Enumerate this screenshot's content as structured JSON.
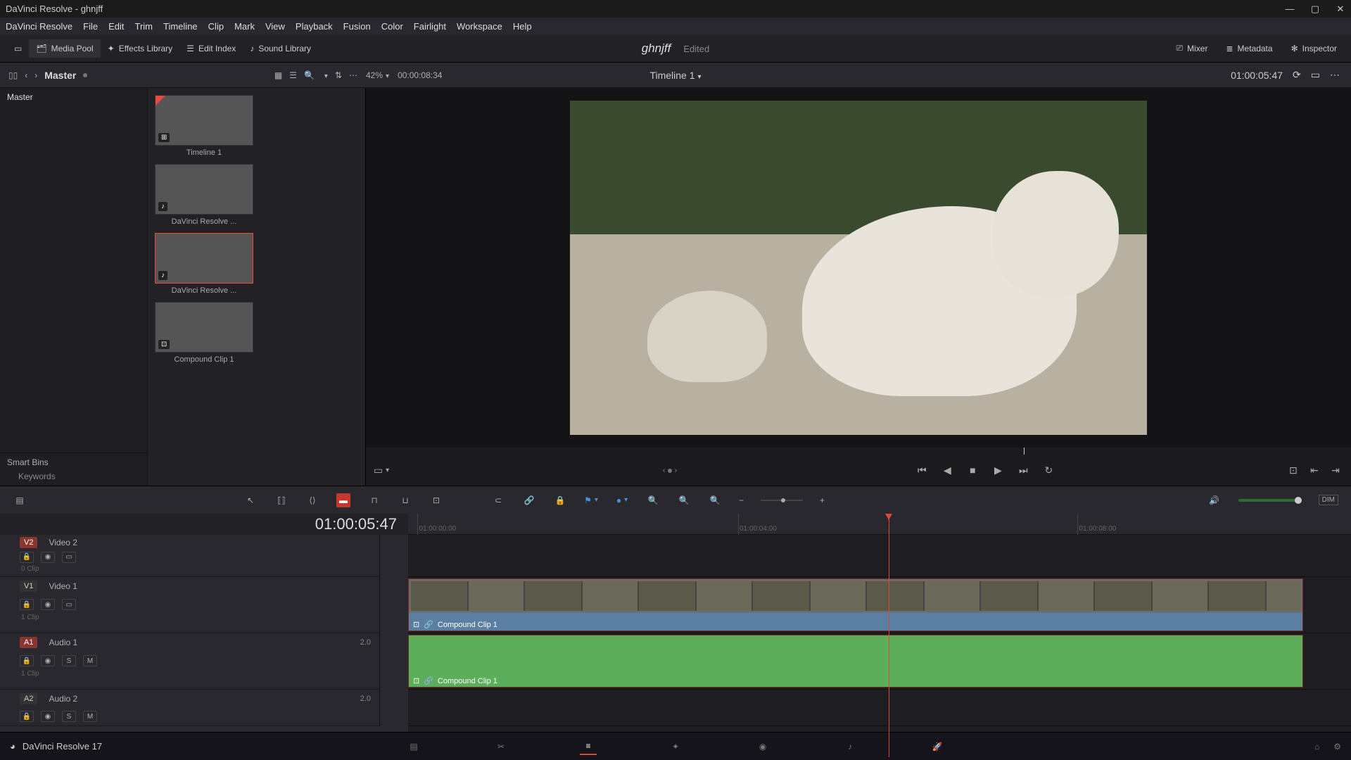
{
  "app": {
    "title": "DaVinci Resolve - ghnjff"
  },
  "window_controls": {
    "min": "—",
    "max": "▢",
    "close": "✕"
  },
  "menu": [
    "DaVinci Resolve",
    "File",
    "Edit",
    "Trim",
    "Timeline",
    "Clip",
    "Mark",
    "View",
    "Playback",
    "Fusion",
    "Color",
    "Fairlight",
    "Workspace",
    "Help"
  ],
  "toolbar": {
    "media_pool": "Media Pool",
    "effects": "Effects Library",
    "edit_index": "Edit Index",
    "sound_library": "Sound Library",
    "mixer": "Mixer",
    "metadata": "Metadata",
    "inspector": "Inspector",
    "project_name": "ghnjff",
    "project_status": "Edited"
  },
  "secbar": {
    "master": "Master",
    "zoom": "42%",
    "src_tc": "00:00:08:34",
    "timeline_name": "Timeline 1",
    "rec_tc": "01:00:05:47"
  },
  "sidebar": {
    "master": "Master",
    "smart_bins": "Smart Bins",
    "keywords": "Keywords"
  },
  "clips": [
    {
      "label": "Timeline 1",
      "icon": "⊞",
      "selected": false,
      "flag": true
    },
    {
      "label": "DaVinci Resolve ...",
      "icon": "♪",
      "selected": false,
      "flag": false
    },
    {
      "label": "DaVinci Resolve ...",
      "icon": "♪",
      "selected": true,
      "flag": false
    },
    {
      "label": "Compound Clip 1",
      "icon": "⊡",
      "selected": false,
      "flag": false
    }
  ],
  "transport": {
    "first": "⏮",
    "prev": "◀",
    "stop": "■",
    "play": "▶",
    "next": "⏭",
    "loop": "↻",
    "match": "⊡",
    "in": "⇤",
    "out": "⇥"
  },
  "tl_toolbar": {
    "arrow": "↖",
    "trim": "⟷",
    "blade": "✂",
    "insert": "⇥",
    "overwrite": "⬓",
    "replace": "⟲",
    "link": "🔗",
    "lock": "🔒",
    "flag": "⚑",
    "marker": "●",
    "search": "🔍",
    "dim": "DIM"
  },
  "timeline": {
    "tc": "01:00:05:47",
    "ruler_marks": [
      "01:00:00:00",
      "",
      "01:00:04:00",
      "",
      "01:00:08:00"
    ],
    "playhead_pct": 51,
    "clip_label": "Compound Clip 1",
    "tracks": {
      "v2": {
        "tag": "V2",
        "name": "Video 2",
        "clips": "0 Clip"
      },
      "v1": {
        "tag": "V1",
        "name": "Video 1",
        "clips": "1 Clip"
      },
      "a1": {
        "tag": "A1",
        "name": "Audio 1",
        "ch": "2.0",
        "clips": "1 Clip"
      },
      "a2": {
        "tag": "A2",
        "name": "Audio 2",
        "ch": "2.0"
      }
    }
  },
  "bottom": {
    "app_label": "DaVinci Resolve 17",
    "home": "⌂",
    "gear": "⚙"
  }
}
